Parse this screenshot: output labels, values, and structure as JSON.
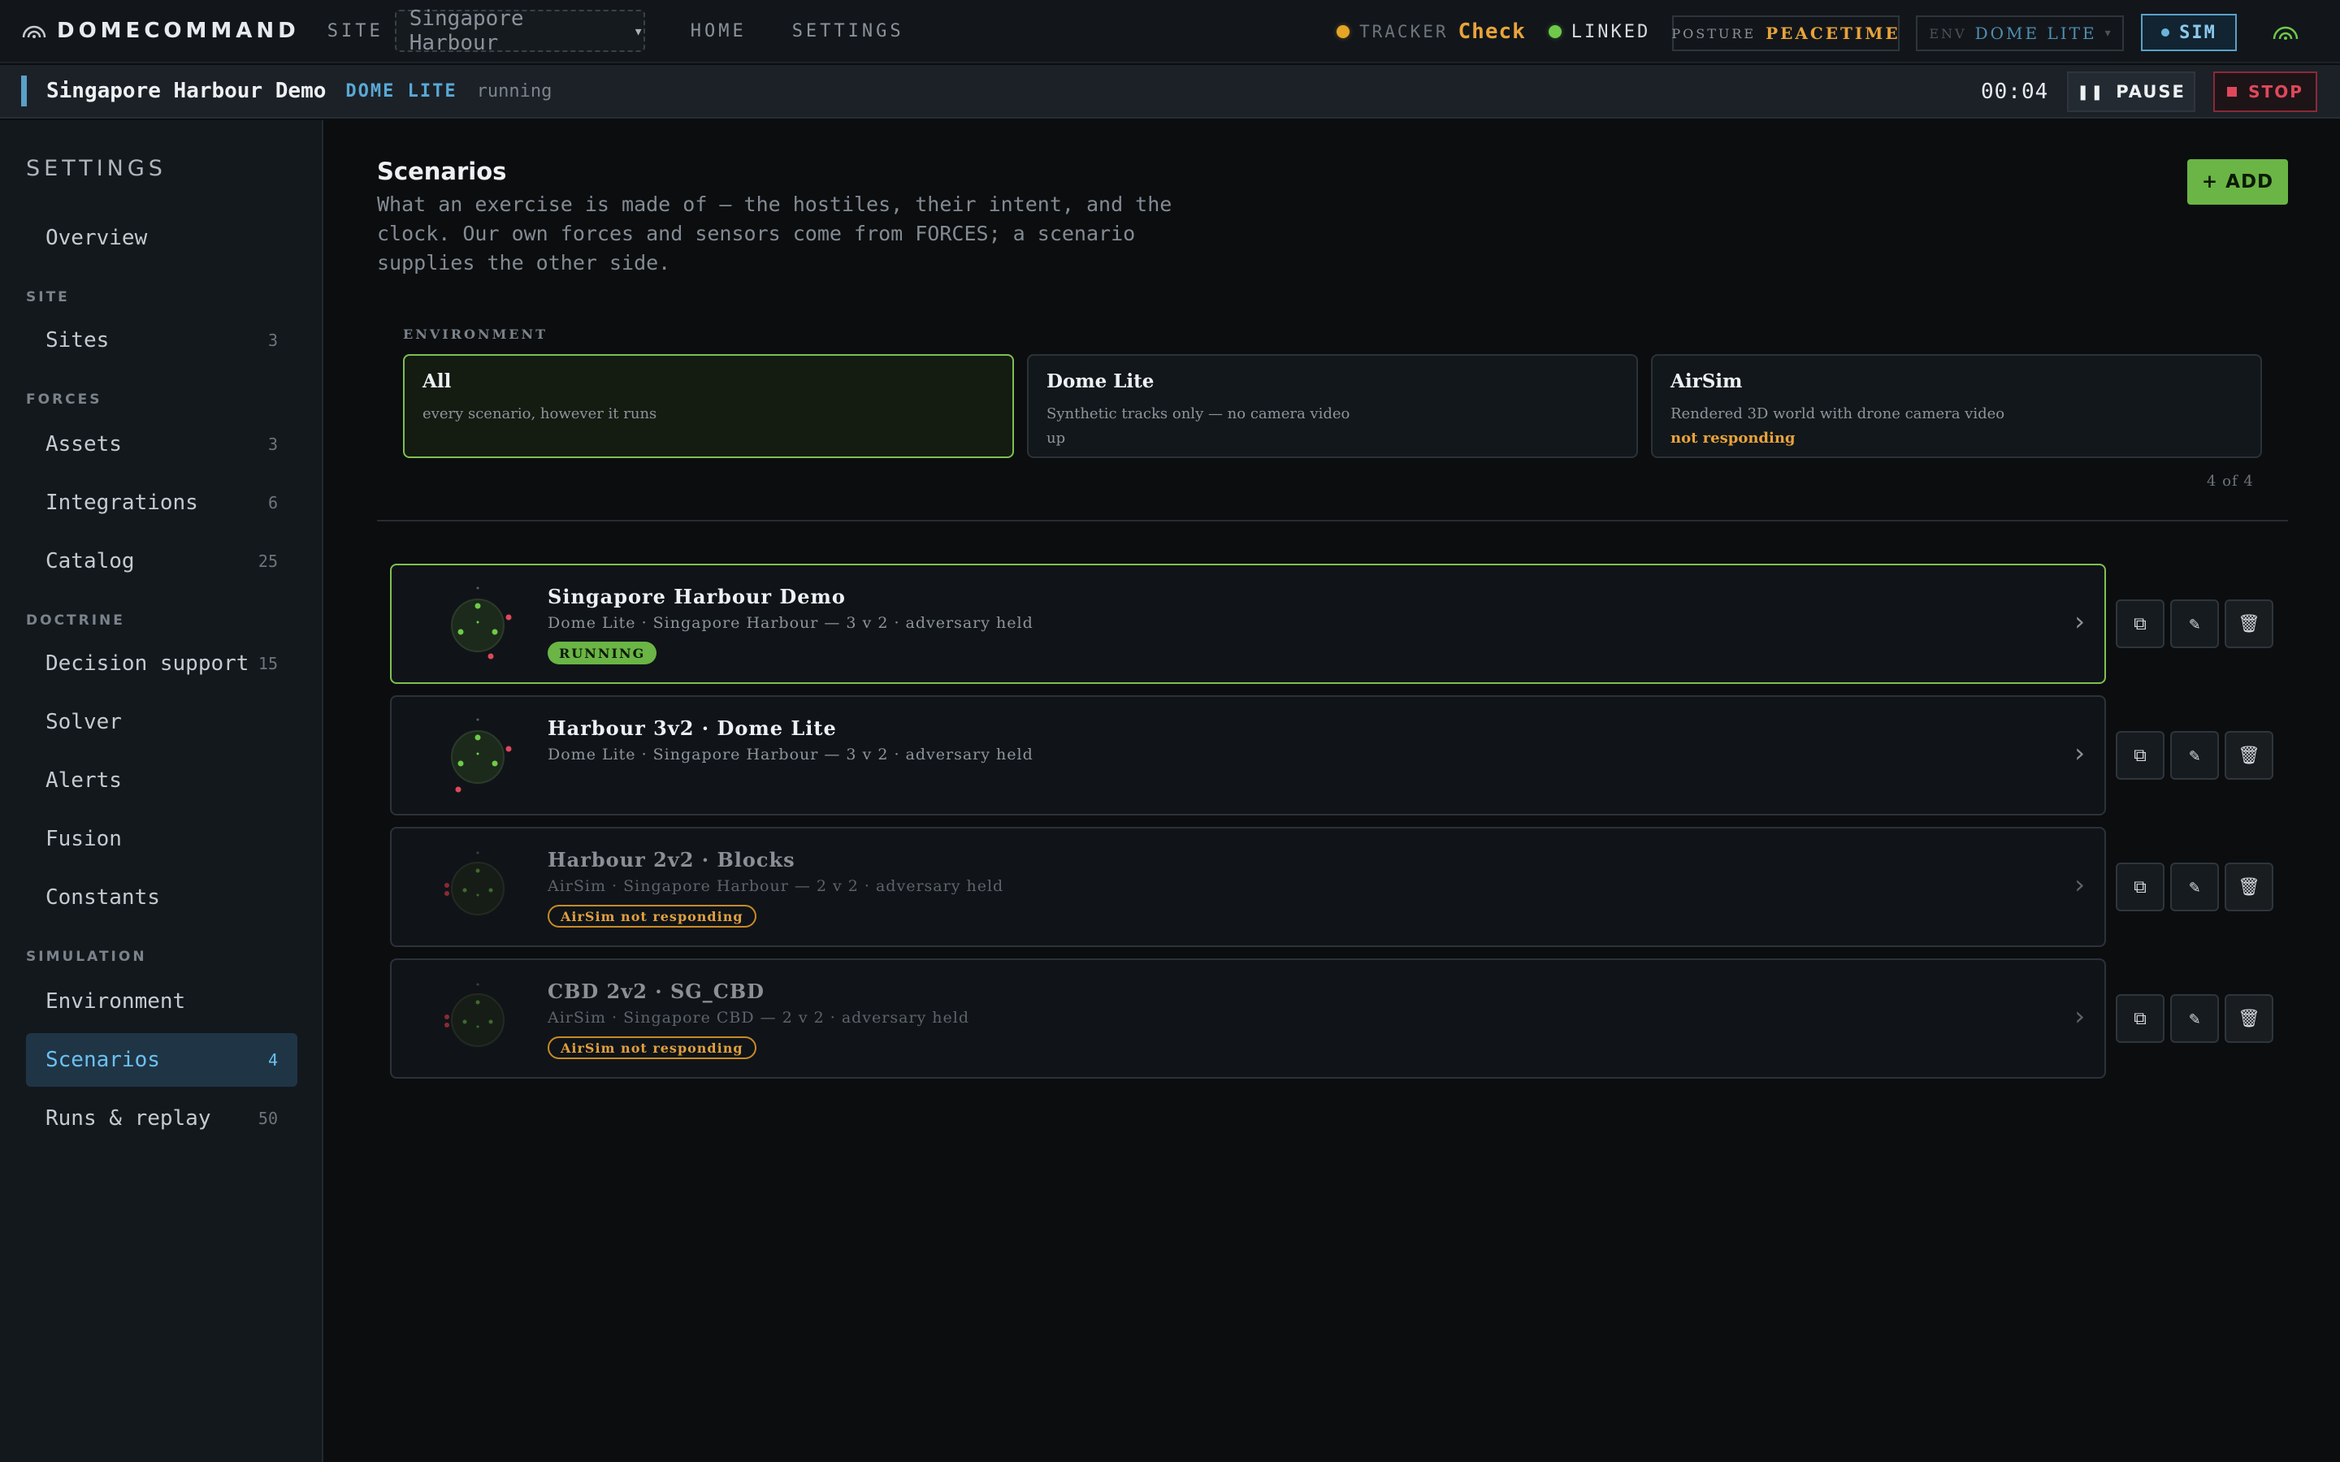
{
  "topbar": {
    "brand": "DOMECOMMAND",
    "site_label": "SITE",
    "site_value": "Singapore Harbour",
    "site_caret": "▾",
    "nav": [
      "HOME",
      "SETTINGS"
    ],
    "tracker_label": "TRACKER",
    "tracker_value": "Check",
    "linked_label": "LINKED",
    "posture_label": "POSTURE",
    "posture_value": "PEACETIME",
    "env_label": "ENV",
    "env_value": "DOME LITE",
    "env_caret": "▾",
    "sim_label": "SIM",
    "colors": {
      "tracker": "#e5a626",
      "linked": "#6fca4a",
      "sim": "#5aa0c8",
      "posture": "#e8a33a"
    }
  },
  "runbar": {
    "name": "Singapore Harbour Demo",
    "env": "DOME LITE",
    "status": "running",
    "clock": "00:04",
    "pause_label": "PAUSE",
    "stop_label": "STOP"
  },
  "sidebar": {
    "title": "SETTINGS",
    "overview": "Overview",
    "sections": {
      "site": "SITE",
      "forces": "FORCES",
      "doctrine": "DOCTRINE",
      "simulation": "SIMULATION"
    },
    "items": [
      {
        "label": "Sites",
        "count": "3"
      },
      {
        "label": "Assets",
        "count": "3"
      },
      {
        "label": "Integrations",
        "count": "6"
      },
      {
        "label": "Catalog",
        "count": "25"
      },
      {
        "label": "Decision support",
        "count": "15"
      },
      {
        "label": "Solver",
        "count": ""
      },
      {
        "label": "Alerts",
        "count": ""
      },
      {
        "label": "Fusion",
        "count": ""
      },
      {
        "label": "Constants",
        "count": ""
      },
      {
        "label": "Environment",
        "count": ""
      },
      {
        "label": "Scenarios",
        "count": "4"
      },
      {
        "label": "Runs & replay",
        "count": "50"
      }
    ]
  },
  "main": {
    "title": "Scenarios",
    "description": "What an exercise is made of — the hostiles, their intent, and the clock. Our own forces and sensors come from FORCES; a scenario supplies the other side.",
    "add_label": "+ ADD",
    "environment_label": "ENVIRONMENT",
    "env_cards": [
      {
        "name": "All",
        "desc": "every scenario, however it runs",
        "status": ""
      },
      {
        "name": "Dome Lite",
        "desc": "Synthetic tracks only — no camera video",
        "status": "up"
      },
      {
        "name": "AirSim",
        "desc": "Rendered 3D world with drone camera video",
        "status": "not responding"
      }
    ],
    "count_text": "4 of 4",
    "scenarios": [
      {
        "title": "Singapore Harbour Demo",
        "sub": "Dome Lite · Singapore Harbour — 3 v 2 · adversary held",
        "badge": "RUNNING"
      },
      {
        "title": "Harbour 3v2 · Dome Lite",
        "sub": "Dome Lite · Singapore Harbour — 3 v 2 · adversary held",
        "badge": ""
      },
      {
        "title": "Harbour 2v2 · Blocks",
        "sub": "AirSim · Singapore Harbour — 2 v 2 · adversary held",
        "badge": "AirSim not responding"
      },
      {
        "title": "CBD 2v2 · SG_CBD",
        "sub": "AirSim · Singapore CBD — 2 v 2 · adversary held",
        "badge": "AirSim not responding"
      }
    ]
  }
}
